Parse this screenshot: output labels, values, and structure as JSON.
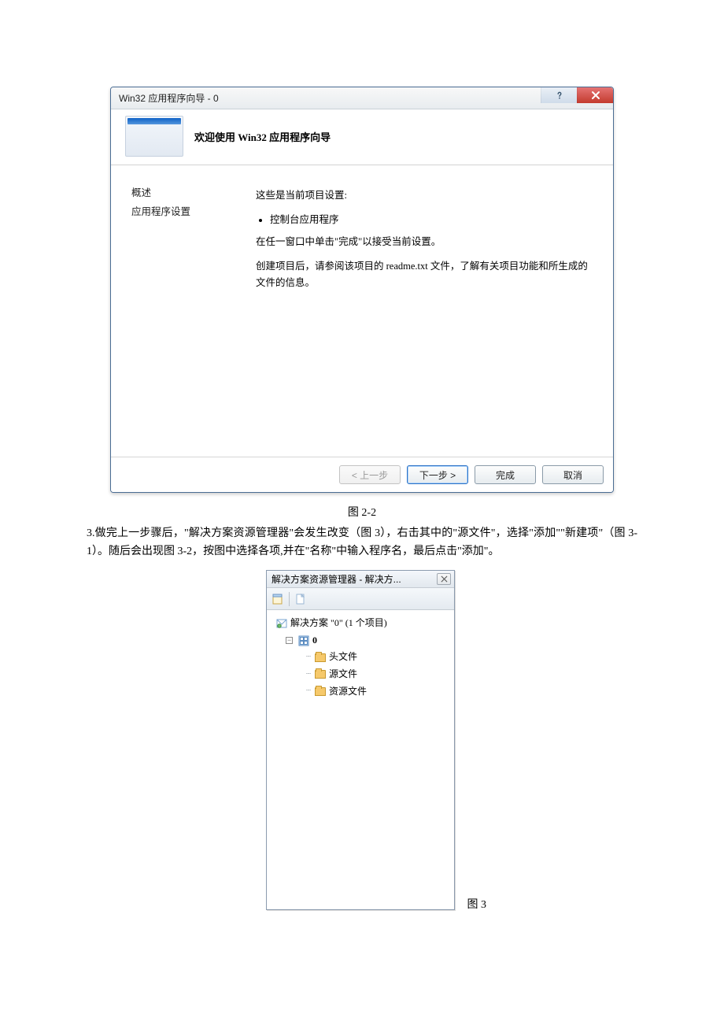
{
  "dialog": {
    "title": "Win32 应用程序向导 - 0",
    "header_title": "欢迎使用 Win32 应用程序向导",
    "sidebar": {
      "item_overview": "概述",
      "item_settings": "应用程序设置"
    },
    "content": {
      "line1": "这些是当前项目设置:",
      "bullet1": "控制台应用程序",
      "line2": "在任一窗口中单击\"完成\"以接受当前设置。",
      "line3": "创建项目后，请参阅该项目的 readme.txt 文件，了解有关项目功能和所生成的文件的信息。"
    },
    "buttons": {
      "prev": "< 上一步",
      "next": "下一步 >",
      "finish": "完成",
      "cancel": "取消"
    }
  },
  "caption1": "图 2-2",
  "paragraph": "3.做完上一步骤后，\"解决方案资源管理器\"会发生改变（图 3），右击其中的\"源文件\"，选择\"添加\"\"新建项\"（图 3-1）。随后会出现图 3-2，按图中选择各项,并在\"名称\"中输入程序名，最后点击\"添加\"。",
  "panel": {
    "title": "解决方案资源管理器 - 解决方...",
    "tree": {
      "solution": "解决方案 \"0\" (1 个项目)",
      "project": "0",
      "headers": "头文件",
      "sources": "源文件",
      "resources": "资源文件"
    }
  },
  "caption2": "图 3"
}
